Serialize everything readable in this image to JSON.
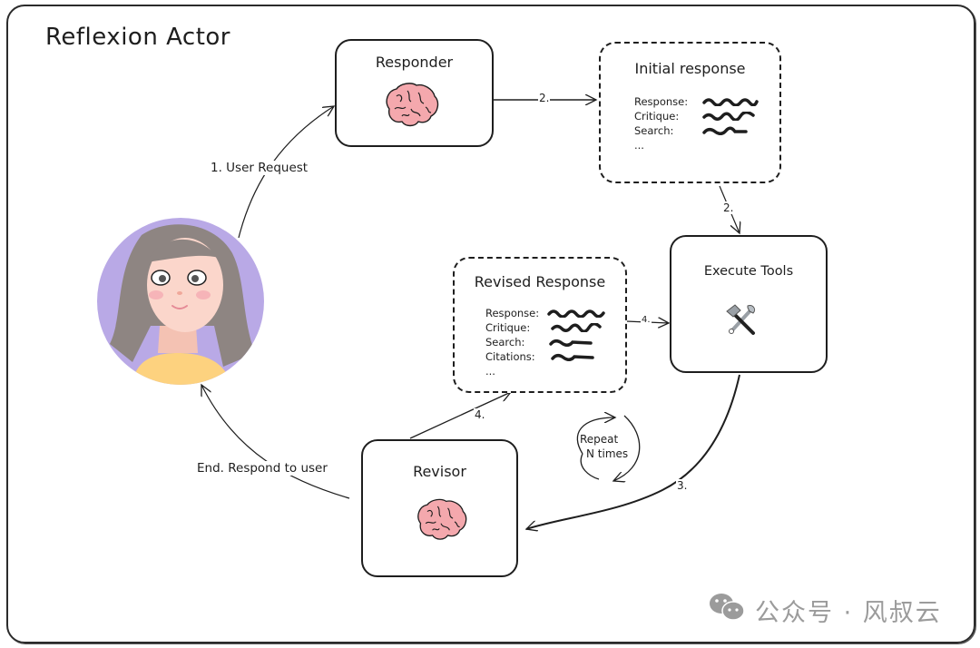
{
  "diagram": {
    "title": "Reflexion Actor",
    "nodes": {
      "responder": {
        "label": "Responder",
        "icon": "brain-icon"
      },
      "initial_response": {
        "label": "Initial response",
        "fields": [
          "Response:",
          "Critique:",
          "Search:",
          "..."
        ]
      },
      "execute_tools": {
        "label": "Execute Tools",
        "icon": "hammer-wrench-icon"
      },
      "revised_response": {
        "label": "Revised Response",
        "fields": [
          "Response:",
          "Critique:",
          "Search:",
          "Citations:",
          "..."
        ]
      },
      "revisor": {
        "label": "Revisor",
        "icon": "brain-icon"
      },
      "user": {
        "icon": "user-avatar"
      }
    },
    "edges": {
      "user_request": "1. User Request",
      "responder_to_initial": "2.",
      "initial_to_tools": "2.",
      "tools_to_revisor": "3.",
      "revisor_to_revised": "4.",
      "revised_to_tools": "4.",
      "end": "End. Respond to user"
    },
    "loop_note": {
      "line1": "Repeat",
      "line2": "N times"
    }
  },
  "watermark": {
    "text": "公众号 · 风叔云",
    "icon": "wechat-icon"
  },
  "colors": {
    "brain": "#f4a8ad",
    "avatar_bg": "#b9a9e6",
    "hair": "#8e8582",
    "skin": "#fbd6cb",
    "shirt": "#fdd27f",
    "ink": "#1e1e1e",
    "watermark": "#9b9b9b"
  }
}
